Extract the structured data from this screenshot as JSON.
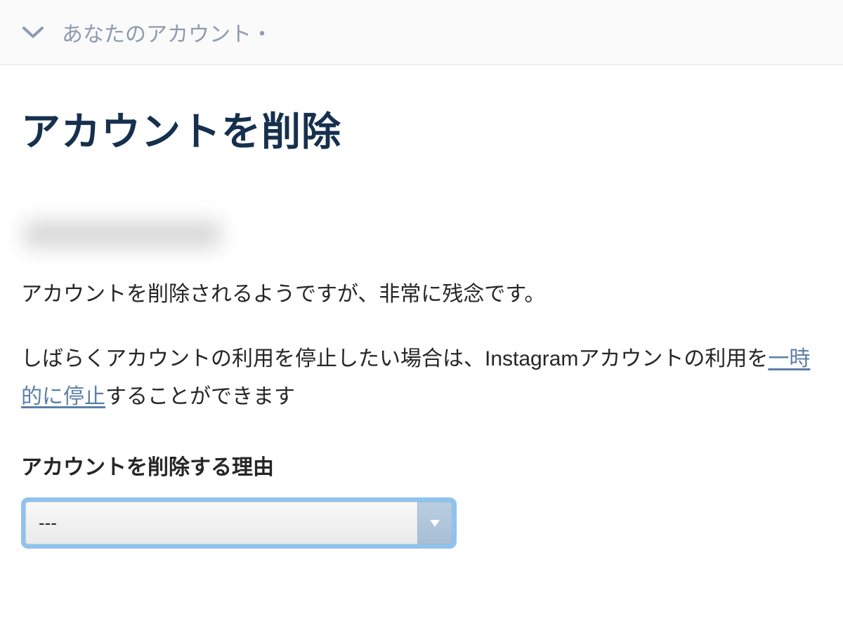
{
  "header": {
    "breadcrumb": "あなたのアカウント・"
  },
  "page": {
    "title": "アカウントを削除",
    "sorry_text": "アカウントを削除されるようですが、非常に残念です。",
    "pause_text_before": "しばらくアカウントの利用を停止したい場合は、Instagramアカウントの利用を",
    "pause_link": "一時的に停止",
    "pause_text_after": "することができます"
  },
  "form": {
    "reason_label": "アカウントを削除する理由",
    "reason_selected": "---"
  }
}
